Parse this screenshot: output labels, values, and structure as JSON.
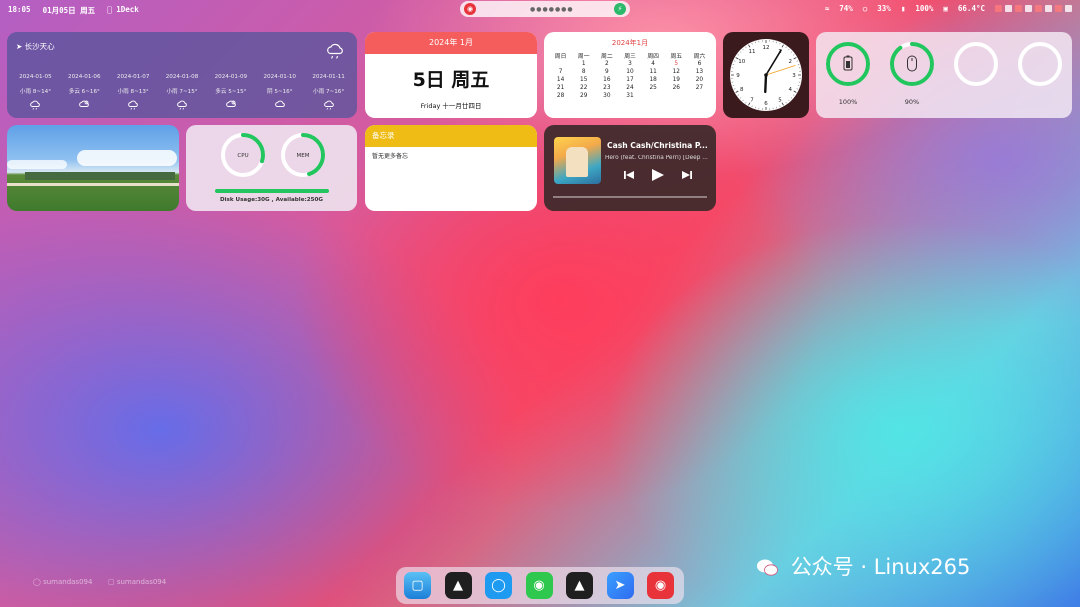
{
  "top_bar": {
    "time": "18:05",
    "date": "01月05日 周五",
    "app_name": "1Deck",
    "status": {
      "battery_wifi": "74%",
      "headphone": "33%",
      "battery": "100%",
      "temp": "66.4°C"
    }
  },
  "weather": {
    "location": "长沙天心",
    "forecast": [
      {
        "date": "2024-01-05",
        "cond": "小雨 8~14°",
        "icon": "rain-icon"
      },
      {
        "date": "2024-01-06",
        "cond": "多云 6~16°",
        "icon": "partly-cloudy-icon"
      },
      {
        "date": "2024-01-07",
        "cond": "小雨 8~13°",
        "icon": "rain-icon"
      },
      {
        "date": "2024-01-08",
        "cond": "小雨 7~15°",
        "icon": "rain-icon"
      },
      {
        "date": "2024-01-09",
        "cond": "多云 5~15°",
        "icon": "partly-cloudy-icon"
      },
      {
        "date": "2024-01-10",
        "cond": "阴 5~16°",
        "icon": "cloudy-icon"
      },
      {
        "date": "2024-01-11",
        "cond": "小雨 7~16°",
        "icon": "rain-icon"
      }
    ]
  },
  "date_card": {
    "header": "2024年 1月",
    "big": "5日 周五",
    "sub": "Friday 十一月廿四日"
  },
  "calendar": {
    "header": "2024年1月",
    "weekdays": [
      "周日",
      "周一",
      "周二",
      "周三",
      "周四",
      "周五",
      "周六"
    ],
    "weeks": [
      [
        "",
        "1",
        "2",
        "3",
        "4",
        "5",
        "6"
      ],
      [
        "7",
        "8",
        "9",
        "10",
        "11",
        "12",
        "13"
      ],
      [
        "14",
        "15",
        "16",
        "17",
        "18",
        "19",
        "20"
      ],
      [
        "21",
        "22",
        "23",
        "24",
        "25",
        "26",
        "27"
      ],
      [
        "28",
        "29",
        "30",
        "31",
        "",
        "",
        ""
      ]
    ],
    "today": "5"
  },
  "clock": {
    "hour": 18,
    "minute": 5,
    "second": 12
  },
  "battery": {
    "devices": [
      {
        "icon": "battery-icon",
        "level": 1.0,
        "label": "100%"
      },
      {
        "icon": "mouse-icon",
        "level": 0.9,
        "label": "90%"
      },
      {
        "icon": "",
        "level": 0,
        "label": ""
      },
      {
        "icon": "",
        "level": 0,
        "label": ""
      }
    ]
  },
  "system": {
    "cpu_label": "CPU",
    "cpu_level": 0.3,
    "mem_label": "MEM",
    "mem_level": 0.45,
    "disk_text": "Disk Usage:30G , Available:250G"
  },
  "memo": {
    "header": "备忘录",
    "body": "暂无更多备忘"
  },
  "music": {
    "title": "Cash Cash/Christina P...",
    "subtitle": "Hero (feat. Christina Perri) [Deep ..."
  },
  "dock": {
    "apps": [
      "finder-icon",
      "app-a-icon",
      "qq-icon",
      "wechat-icon",
      "app-b-icon",
      "feishu-icon",
      "netease-music-icon"
    ]
  },
  "watermarks": {
    "left1": "sumandas094",
    "left2": "sumandas094",
    "brand": "公众号 · Linux265"
  },
  "colors": {
    "green": "#22c55e",
    "red_header": "#f55c5c",
    "memo_header": "#eebc14"
  }
}
